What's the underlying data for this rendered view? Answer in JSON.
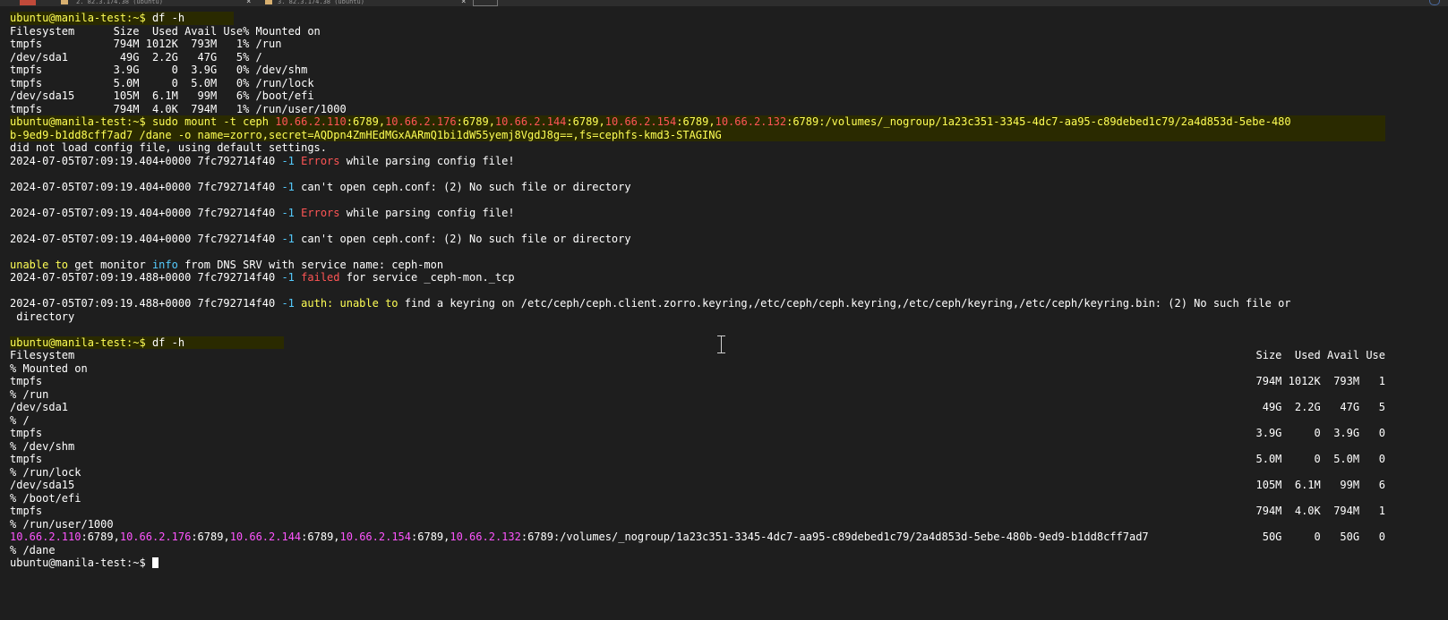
{
  "tabs": [
    {
      "label": "2. 82.3.174.38 (ubuntu)"
    },
    {
      "label": "3. 82.3.174.38 (ubuntu)"
    }
  ],
  "prompt": "ubuntu@manila-test:~$",
  "cmd_df": "df -h",
  "df1": {
    "header": "Filesystem      Size  Used Avail Use% Mounted on",
    "rows": [
      "tmpfs           794M 1012K  793M   1% /run",
      "/dev/sda1        49G  2.2G   47G   5% /",
      "tmpfs           3.9G     0  3.9G   0% /dev/shm",
      "tmpfs           5.0M     0  5.0M   0% /run/lock",
      "/dev/sda15      105M  6.1M   99M   6% /boot/efi",
      "tmpfs           794M  4.0K  794M   1% /run/user/1000"
    ]
  },
  "mount": {
    "cmd_prefix": "sudo mount -t ceph",
    "ips": [
      "10.66.2.110",
      "10.66.2.176",
      "10.66.2.144",
      "10.66.2.154",
      "10.66.2.132"
    ],
    "port": ":6789",
    "comma": ",",
    "path_line1": ":/volumes/_nogroup/1a23c351-3345-4dc7-aa95-c89debed1c79/2a4d853d-5ebe-480",
    "line2": "b-9ed9-b1dd8cff7ad7 /dane -o name=zorro,secret=AQDpn4ZmHEdMGxAARmQ1bi1dW55yemj8VgdJ8g==,fs=cephfs-kmd3-STAGING"
  },
  "log": {
    "no_config": "did not load config file, using default settings.",
    "ts1": "2024-07-05T07:09:19.404+0000 7fc792714f40",
    "ts2": "2024-07-05T07:09:19.488+0000 7fc792714f40",
    "level": "-1",
    "errors": "Errors",
    "while_parsing": " while parsing config file!",
    "cant_open": "can't open ceph.conf: (2) No such file or directory",
    "unable_to": "unable to",
    "get_monitor": " get monitor ",
    "info": "info",
    "from_dns": " from DNS SRV with service name: ceph-mon",
    "failed": "failed",
    "for_service": " for service _ceph-mon._tcp",
    "auth": "auth:",
    "find_keyring": " find a keyring on /etc/ceph/ceph.client.zorro.keyring,/etc/ceph/ceph.keyring,/etc/ceph/keyring,/etc/ceph/keyring.bin: (2) No such file or",
    "directory": " directory"
  },
  "df2": {
    "header_left": "Filesystem",
    "header_right": "Size  Used Avail Use",
    "header_cont": "% Mounted on",
    "rows": [
      {
        "fs": "tmpfs",
        "nums": "794M 1012K  793M   1",
        "cont": "% /run"
      },
      {
        "fs": "/dev/sda1",
        "nums": " 49G  2.2G   47G   5",
        "cont": "% /"
      },
      {
        "fs": "tmpfs",
        "nums": "3.9G     0  3.9G   0",
        "cont": "% /dev/shm"
      },
      {
        "fs": "tmpfs",
        "nums": "5.0M     0  5.0M   0",
        "cont": "% /run/lock"
      },
      {
        "fs": "/dev/sda15",
        "nums": "105M  6.1M   99M   6",
        "cont": "% /boot/efi"
      },
      {
        "fs": "tmpfs",
        "nums": "794M  4.0K  794M   1",
        "cont": "% /run/user/1000"
      }
    ],
    "ceph_path": ":/volumes/_nogroup/1a23c351-3345-4dc7-aa95-c89debed1c79/2a4d853d-5ebe-480b-9ed9-b1dd8cff7ad7",
    "ceph_nums": " 50G     0   50G   0",
    "ceph_cont": "% /dane"
  },
  "colors": {
    "prompt": "#ffff55",
    "ip": "#ff5555",
    "ip_listing": "#ff55ff",
    "level": "#55ccff",
    "error": "#ff5555",
    "background": "#1e1e1e"
  }
}
